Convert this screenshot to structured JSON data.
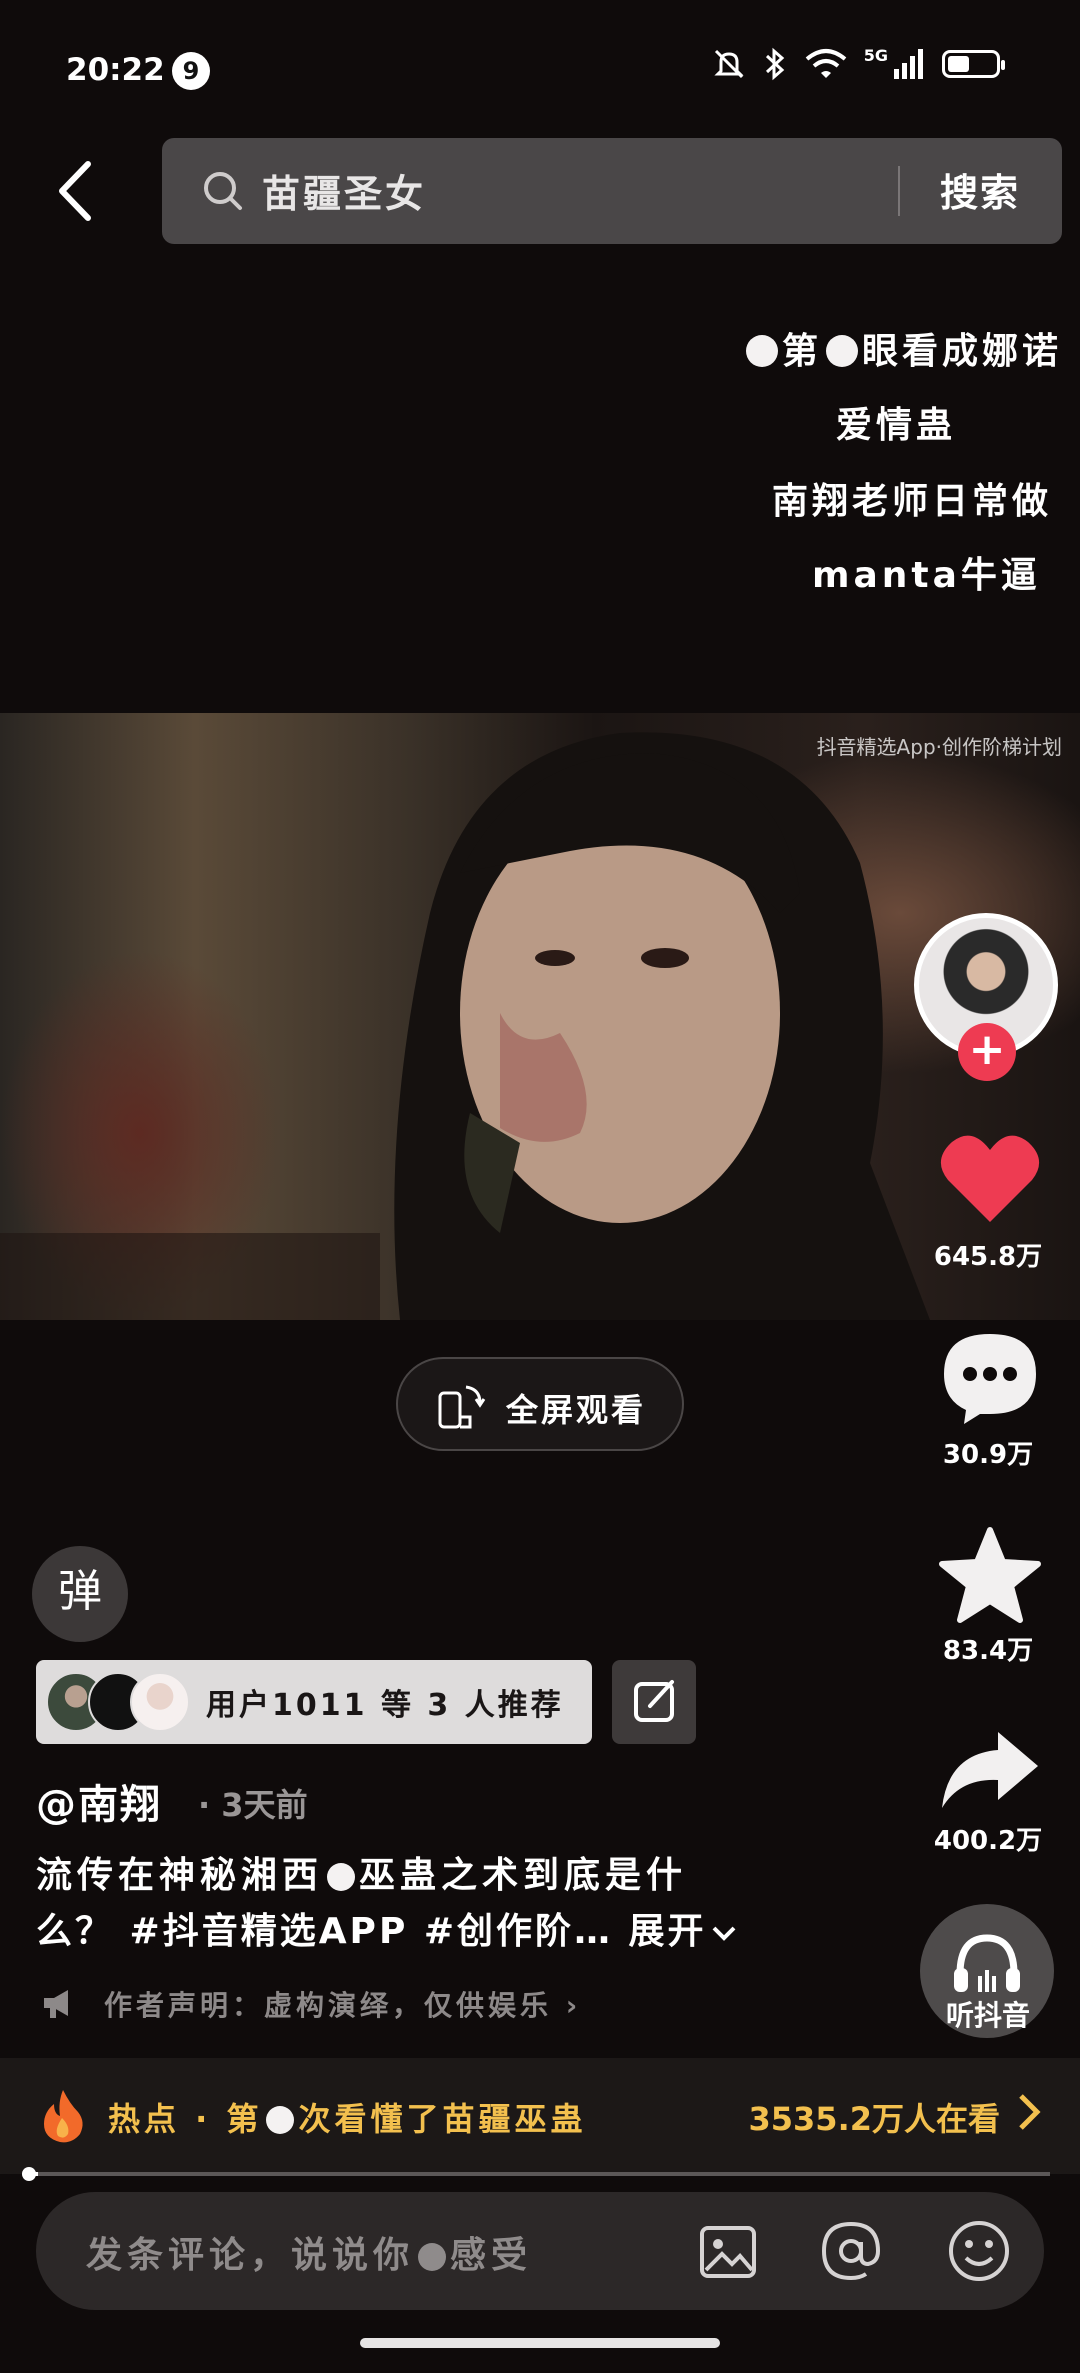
{
  "status_bar": {
    "time": "20:22",
    "notification_count": "9",
    "network": "5G",
    "battery_percent": 45,
    "icons": [
      "mute-icon",
      "bluetooth-icon",
      "wifi-icon",
      "signal-icon",
      "battery-icon"
    ]
  },
  "search": {
    "query": "苗疆圣女",
    "button_label": "搜索"
  },
  "overlay_captions": [
    {
      "before": "",
      "middle": "第",
      "after": "眼看成娜诺"
    },
    {
      "text": "爱情蛊"
    },
    {
      "text": "南翔老师日常做"
    },
    {
      "text": "manta牛逼"
    }
  ],
  "video": {
    "watermark": "抖音精选App·创作阶梯计划"
  },
  "fullscreen": {
    "label": "全屏观看"
  },
  "actions": {
    "likes": "645.8万",
    "comments": "30.9万",
    "favorites": "83.4万",
    "shares": "400.2万",
    "listen_label": "听抖音"
  },
  "danmu": {
    "label": "弹"
  },
  "recommendation": {
    "text": "用户1011 等 3 人推荐"
  },
  "post": {
    "author": "@南翔",
    "time": "· 3天前",
    "description_line1": "流传在神秘湘西",
    "description_line1b": "巫蛊之术到底是什",
    "description_line2": "么？ #抖音精选APP #创作阶… 展开",
    "disclaimer": "作者声明：虚构演绎，仅供娱乐"
  },
  "hot": {
    "prefix": "热点 · 第",
    "suffix": "次看懂了苗疆巫蛊",
    "viewers": "3535.2万人在看"
  },
  "progress": {
    "value": 0.01
  },
  "comment_bar": {
    "placeholder_a": "发条评论，说说你",
    "placeholder_b": "感受"
  },
  "colors": {
    "background": "#0f0b0b",
    "accent_red": "#ee3b52",
    "hot_yellow": "#f3c04e"
  }
}
